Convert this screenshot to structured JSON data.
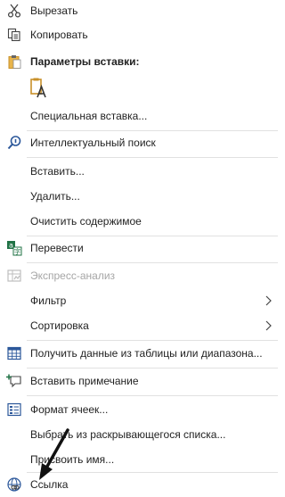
{
  "menu": {
    "cut": "Вырезать",
    "copy": "Копировать",
    "paste_options": "Параметры вставки:",
    "paste_special": "Специальная вставка...",
    "smart_lookup": "Интеллектуальный поиск",
    "insert": "Вставить...",
    "delete": "Удалить...",
    "clear_contents": "Очистить содержимое",
    "translate": "Перевести",
    "quick_analysis": "Экспресс-анализ",
    "filter": "Фильтр",
    "sort": "Сортировка",
    "get_data": "Получить данные из таблицы или диапазона...",
    "insert_comment": "Вставить примечание",
    "format_cells": "Формат ячеек...",
    "pick_from_list": "Выбрать из раскрывающегося списка...",
    "define_name": "Присвоить имя...",
    "link": "Ссылка"
  },
  "icons": {
    "cut": "scissors-icon",
    "copy": "copy-icon",
    "paste_options": "clipboard-icon",
    "paste_keep_text": "paste-text-only-icon",
    "smart_lookup": "search-icon",
    "translate": "translate-icon",
    "quick_analysis": "quick-analysis-icon",
    "get_data": "table-icon",
    "insert_comment": "comment-icon",
    "format_cells": "format-cells-icon",
    "link": "link-icon"
  },
  "colors": {
    "text": "#222222",
    "disabled": "#a6a6a6",
    "accent": "#2b579a",
    "green": "#217346",
    "clipboard": "#c8902a",
    "separator": "#e1e1e1"
  }
}
